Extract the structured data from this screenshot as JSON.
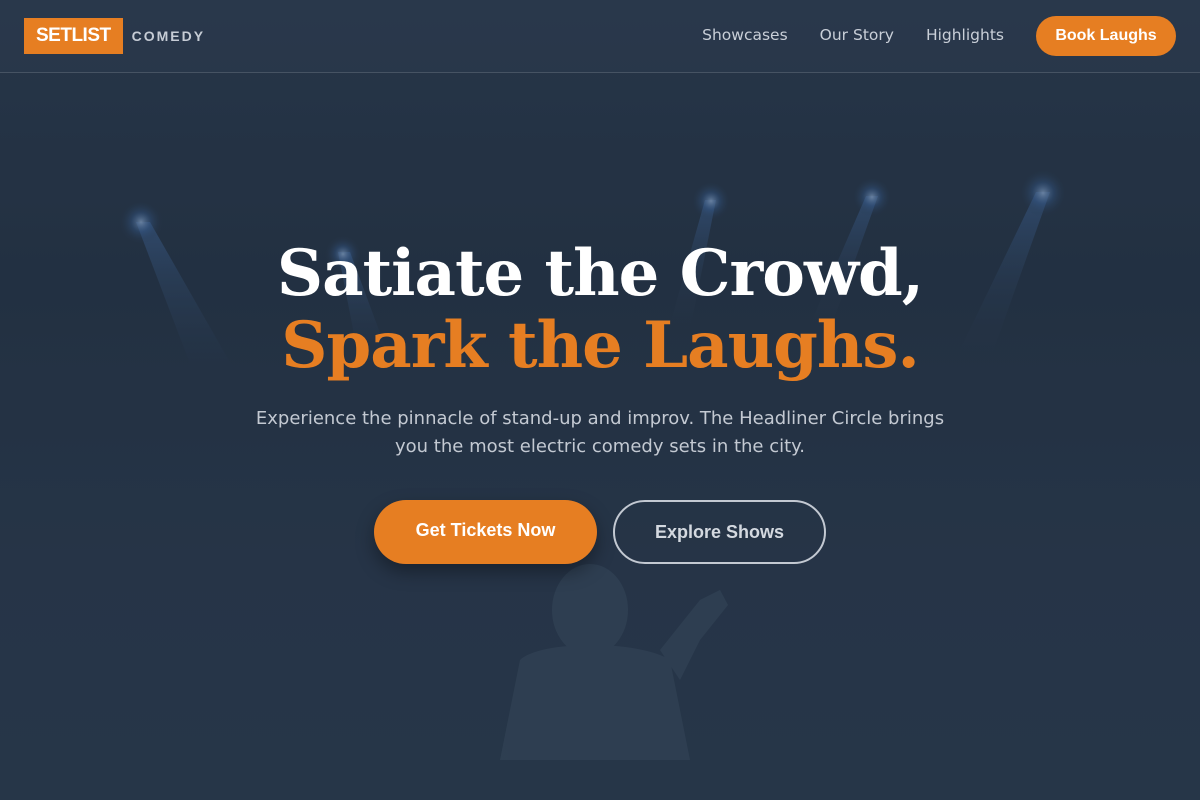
{
  "colors": {
    "accent": "#e67e22",
    "background": "#2b3a4e",
    "text_muted": "#c3c9d2"
  },
  "nav": {
    "logo_mark": "SETLIST",
    "logo_text": "COMEDY",
    "links": [
      "Showcases",
      "Our Story",
      "Highlights"
    ],
    "cta": "Book Laughs"
  },
  "hero": {
    "headline_line1": "Satiate the Crowd,",
    "headline_line2": "Spark the Laughs.",
    "subtext": "Experience the pinnacle of stand-up and improv. The Headliner Circle brings you the most electric comedy sets in the city.",
    "primary_button": "Get Tickets Now",
    "secondary_button": "Explore Shows",
    "background_image": "stage-spotlights-comedian-icon"
  }
}
